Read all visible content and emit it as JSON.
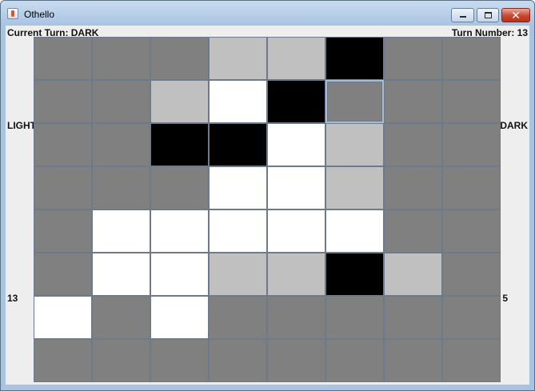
{
  "window": {
    "title": "Othello",
    "icon": "java-cup-icon"
  },
  "status": {
    "current_turn": "Current Turn: DARK",
    "turn_number": "Turn Number: 13"
  },
  "players": {
    "light": {
      "name": "LIGHT",
      "score": "13"
    },
    "dark": {
      "name": "DARK",
      "score": "5"
    }
  },
  "board": {
    "size": 8,
    "legend": {
      "E": "empty",
      "D": "dark-piece",
      "L": "light-piece",
      "H": "valid-move-highlight",
      "F": "focused-empty"
    },
    "rows": [
      [
        "E",
        "E",
        "E",
        "H",
        "H",
        "D",
        "E",
        "E"
      ],
      [
        "E",
        "E",
        "H",
        "L",
        "D",
        "F",
        "E",
        "E"
      ],
      [
        "E",
        "E",
        "D",
        "D",
        "L",
        "H",
        "E",
        "E"
      ],
      [
        "E",
        "E",
        "E",
        "L",
        "L",
        "H",
        "E",
        "E"
      ],
      [
        "E",
        "L",
        "L",
        "L",
        "L",
        "L",
        "E",
        "E"
      ],
      [
        "E",
        "L",
        "L",
        "H",
        "H",
        "D",
        "H",
        "E"
      ],
      [
        "L",
        "E",
        "L",
        "E",
        "E",
        "E",
        "E",
        "E"
      ],
      [
        "E",
        "E",
        "E",
        "E",
        "E",
        "E",
        "E",
        "E"
      ]
    ]
  },
  "colors": {
    "empty": "#808080",
    "dark": "#000000",
    "light": "#ffffff",
    "highlight": "#c0c0c0",
    "grid_line": "#6b7b8c"
  }
}
